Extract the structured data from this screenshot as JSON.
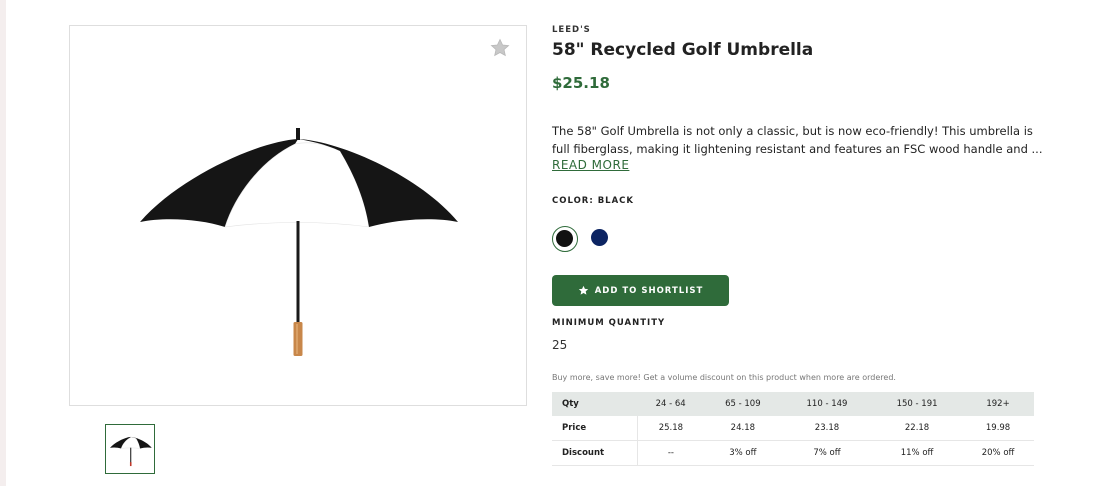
{
  "product": {
    "brand": "LEED'S",
    "title": "58\" Recycled Golf Umbrella",
    "price": "$25.18",
    "description_lines": [
      "The 58\" Golf Umbrella is not only a classic, but is now eco-friendly! This umbrella is",
      "full fiberglass, making it lightening resistant and features an FSC wood handle and ..."
    ],
    "read_more": "READ MORE",
    "color_label": "COLOR: BLACK",
    "colors": [
      {
        "name": "Black",
        "hex": "#111111",
        "selected": true
      },
      {
        "name": "Navy",
        "hex": "#0c2462",
        "selected": false
      }
    ],
    "shortlist_button": "ADD TO SHORTLIST",
    "min_qty_label": "MINIMUM QUANTITY",
    "min_qty_value": "25",
    "volume_note": "Buy more, save more! Get a volume discount on this product when more are ordered."
  },
  "pricing_table": {
    "header": [
      "Qty",
      "24 - 64",
      "65 - 109",
      "110 - 149",
      "150 - 191",
      "192+"
    ],
    "price": [
      "Price",
      "25.18",
      "24.18",
      "23.18",
      "22.18",
      "19.98"
    ],
    "discount": [
      "Discount",
      "--",
      "3% off",
      "7% off",
      "11% off",
      "20% off"
    ]
  },
  "colors": {
    "accent": "#2f6b3a",
    "table_header_bg": "#e4e8e6"
  },
  "icons": {
    "favorite": "star-icon",
    "shortlist": "star-icon"
  }
}
